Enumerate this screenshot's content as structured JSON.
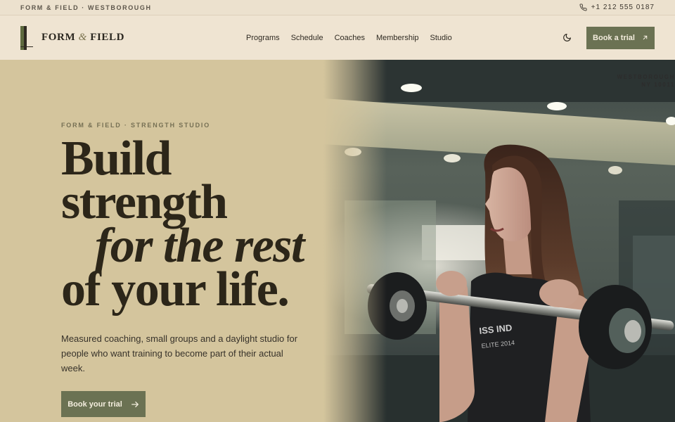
{
  "topbar": {
    "brand": "FORM & FIELD · WESTBOROUGH",
    "phone": "+1 212 555 0187",
    "phone_icon": "phone-icon"
  },
  "header": {
    "logo_word1": "FORM",
    "logo_amp": "&",
    "logo_word2": "FIELD",
    "nav": [
      {
        "label": "Programs"
      },
      {
        "label": "Schedule"
      },
      {
        "label": "Coaches"
      },
      {
        "label": "Membership"
      },
      {
        "label": "Studio"
      }
    ],
    "theme_icon": "moon-icon",
    "cta_label": "Book a trial",
    "cta_icon": "arrow-up-right-icon"
  },
  "hero": {
    "eyebrow": "FORM & FIELD · STRENGTH STUDIO",
    "headline_1": "Build",
    "headline_2": "strength",
    "headline_3": "for the rest",
    "headline_4": "of your life.",
    "lede": "Measured coaching, small groups and a daylight studio for people who want training to become part of their actual week.",
    "cta_label": "Book your trial",
    "cta_icon": "arrow-right-icon",
    "address_line1": "WESTBOROUGH",
    "address_line2": "NY 10011"
  },
  "colors": {
    "background": "#efe4d2",
    "hero_bg": "#d4c59d",
    "accent": "#6b7253",
    "ink": "#2c2619"
  }
}
